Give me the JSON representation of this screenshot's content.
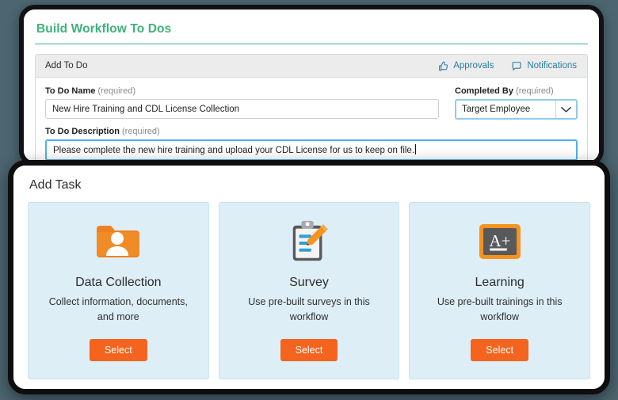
{
  "back_panel": {
    "title": "Build Workflow To Dos",
    "subcard": {
      "header_label": "Add To Do",
      "actions": [
        {
          "label": "Approvals",
          "icon": "thumbs-up-icon"
        },
        {
          "label": "Notifications",
          "icon": "speech-bubble-icon"
        }
      ],
      "fields": {
        "todo_name": {
          "label": "To Do Name",
          "required_text": "(required)",
          "value": "New Hire Training and CDL License Collection",
          "placeholder": ""
        },
        "completed_by": {
          "label": "Completed By",
          "required_text": "(required)",
          "value": "Target Employee",
          "arrow_icon": "chevron-down-icon"
        },
        "todo_description": {
          "label": "To Do Description",
          "required_text": "(required)",
          "value": "Please complete the new hire training and upload your CDL License for us to keep on file.",
          "placeholder": ""
        }
      }
    }
  },
  "modal": {
    "title": "Add Task",
    "cards": [
      {
        "title": "Data Collection",
        "description": "Collect information, documents, and more",
        "button_label": "Select",
        "icon": "folder-person-icon"
      },
      {
        "title": "Survey",
        "description": "Use pre-built surveys in this workflow",
        "button_label": "Select",
        "icon": "clipboard-pencil-icon"
      },
      {
        "title": "Learning",
        "description": "Use pre-built trainings in this workflow",
        "button_label": "Select",
        "icon": "chalkboard-aplus-icon"
      }
    ]
  },
  "colors": {
    "accent_green": "#3eb27a",
    "accent_orange": "#f4641e",
    "link_blue": "#2b7ea1",
    "card_blue": "#ddeef7",
    "focus_blue": "#4fb3e8",
    "page_background": "#4c6570"
  }
}
